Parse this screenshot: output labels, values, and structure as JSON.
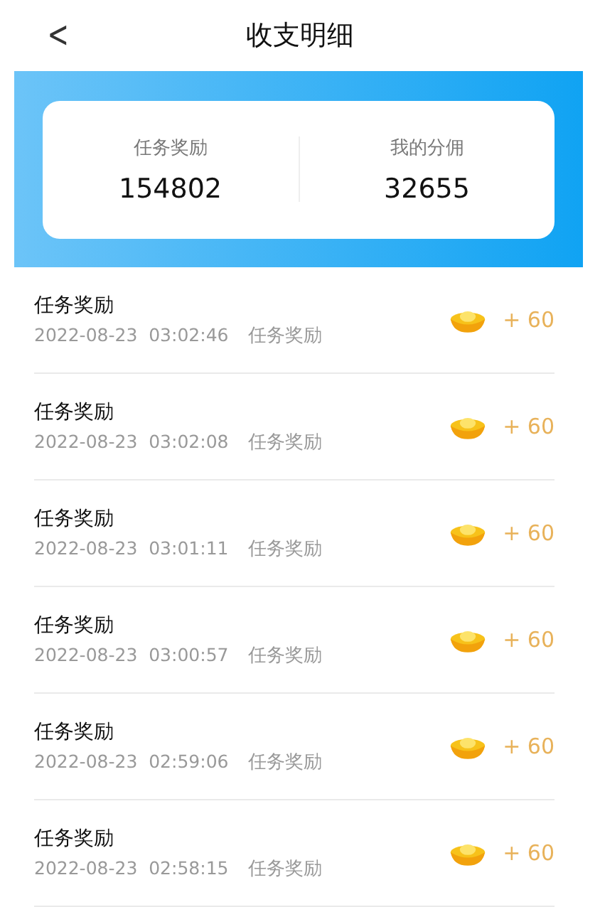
{
  "header": {
    "back": "<",
    "title": "收支明细"
  },
  "summary": [
    {
      "label": "任务奖励",
      "value": "154802"
    },
    {
      "label": "我的分佣",
      "value": "32655"
    }
  ],
  "records": [
    {
      "title": "任务奖励",
      "time": "2022-08-23  03:02:46",
      "type": "任务奖励",
      "amount": "+ 60"
    },
    {
      "title": "任务奖励",
      "time": "2022-08-23  03:02:08",
      "type": "任务奖励",
      "amount": "+ 60"
    },
    {
      "title": "任务奖励",
      "time": "2022-08-23  03:01:11",
      "type": "任务奖励",
      "amount": "+ 60"
    },
    {
      "title": "任务奖励",
      "time": "2022-08-23  03:00:57",
      "type": "任务奖励",
      "amount": "+ 60"
    },
    {
      "title": "任务奖励",
      "time": "2022-08-23  02:59:06",
      "type": "任务奖励",
      "amount": "+ 60"
    },
    {
      "title": "任务奖励",
      "time": "2022-08-23  02:58:15",
      "type": "任务奖励",
      "amount": "+ 60"
    }
  ]
}
